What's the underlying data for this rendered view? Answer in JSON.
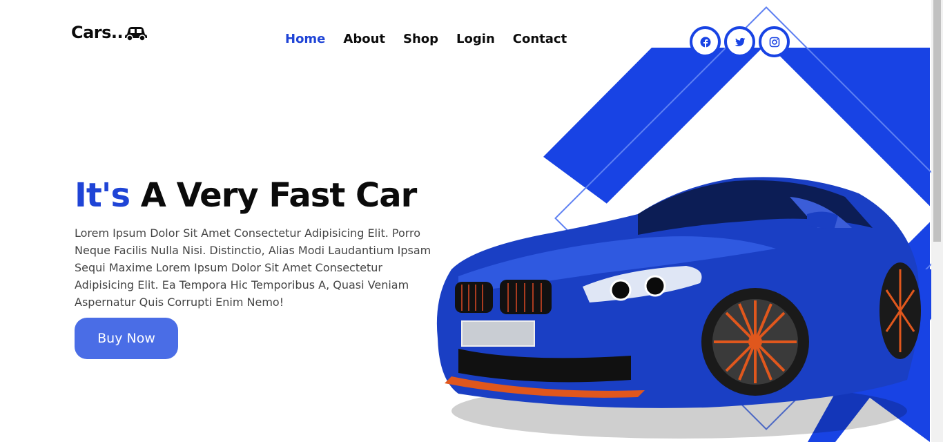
{
  "brand": {
    "name": "Cars.."
  },
  "nav": {
    "items": [
      {
        "label": "Home",
        "active": true
      },
      {
        "label": "About",
        "active": false
      },
      {
        "label": "Shop",
        "active": false
      },
      {
        "label": "Login",
        "active": false
      },
      {
        "label": "Contact",
        "active": false
      }
    ]
  },
  "social": [
    "facebook-icon",
    "twitter-icon",
    "instagram-icon"
  ],
  "hero": {
    "headline_accent": "It's",
    "headline_rest": "A Very Fast Car",
    "description": "Lorem Ipsum Dolor Sit Amet Consectetur Adipisicing Elit. Porro Neque Facilis Nulla Nisi. Distinctio, Alias Modi Laudantium Ipsam Sequi Maxime Lorem Ipsum Dolor Sit Amet Consectetur Adipisicing Elit. Ea Tempora Hic Temporibus A, Quasi Veniam Aspernatur Quis Corrupti Enim Nemo!",
    "cta": "Buy Now"
  },
  "colors": {
    "accent": "#1f44d6",
    "shape": "#1843e4",
    "button": "#4a6de6"
  }
}
